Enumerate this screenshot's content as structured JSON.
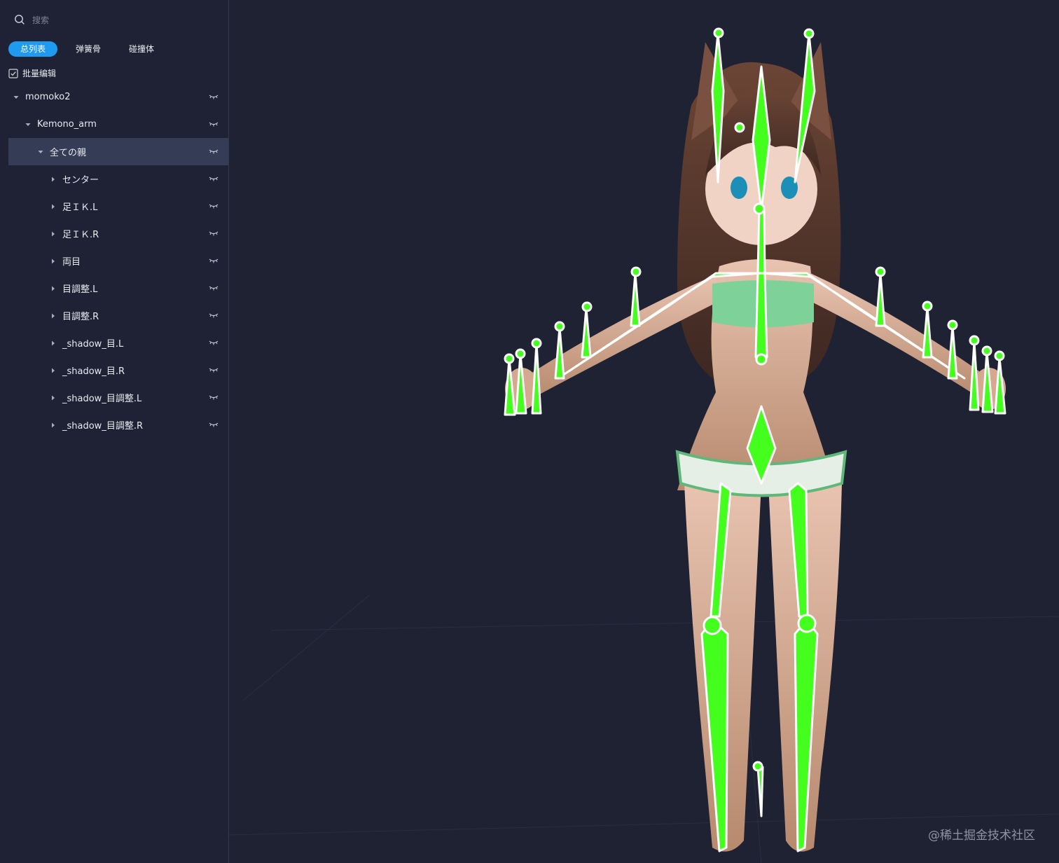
{
  "sidebar": {
    "search_placeholder": "搜索",
    "tabs": [
      {
        "label": "总列表",
        "active": true
      },
      {
        "label": "弹簧骨",
        "active": false
      },
      {
        "label": "碰撞体",
        "active": false
      }
    ],
    "batch_edit_label": "批量编辑",
    "tree": [
      {
        "label": "momoko2",
        "expanded": true,
        "selected": false
      },
      {
        "label": "Kemono_arm",
        "expanded": true,
        "selected": false
      },
      {
        "label": "全ての親",
        "expanded": true,
        "selected": true
      },
      {
        "label": "センター",
        "expanded": false,
        "selected": false
      },
      {
        "label": "足ＩＫ.L",
        "expanded": false,
        "selected": false
      },
      {
        "label": "足ＩＫ.R",
        "expanded": false,
        "selected": false
      },
      {
        "label": "両目",
        "expanded": false,
        "selected": false
      },
      {
        "label": "目調整.L",
        "expanded": false,
        "selected": false
      },
      {
        "label": "目調整.R",
        "expanded": false,
        "selected": false
      },
      {
        "label": "_shadow_目.L",
        "expanded": false,
        "selected": false
      },
      {
        "label": "_shadow_目.R",
        "expanded": false,
        "selected": false
      },
      {
        "label": "_shadow_目調整.L",
        "expanded": false,
        "selected": false
      },
      {
        "label": "_shadow_目調整.R",
        "expanded": false,
        "selected": false
      }
    ]
  },
  "viewport": {
    "watermark": "@稀土掘金技术社区"
  },
  "colors": {
    "accent": "#1e9bf0",
    "selected_row": "#353c55",
    "bone": "#44ff1e",
    "background": "#1f2233"
  },
  "icons": {
    "search": "search-icon",
    "batch": "checkbox-icon",
    "visibility": "eye-closed-icon",
    "expand": "caret-down-icon",
    "collapse": "caret-right-icon"
  }
}
